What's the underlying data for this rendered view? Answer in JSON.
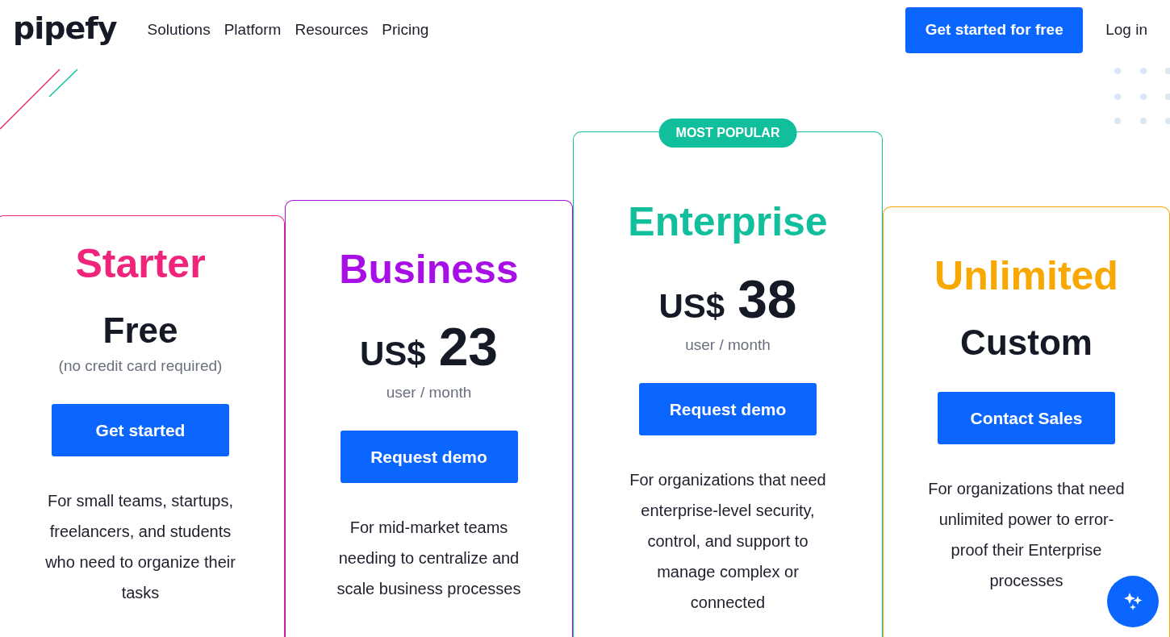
{
  "header": {
    "logo": "pipefy",
    "nav": [
      "Solutions",
      "Platform",
      "Resources",
      "Pricing"
    ],
    "cta": "Get started for free",
    "login": "Log in"
  },
  "plans": [
    {
      "name": "Starter",
      "color": "#f0247a",
      "amount": "Free",
      "note": "(no credit card required)",
      "button": "Get started",
      "description": "For small teams, startups, freelancers, and students who need to organize their tasks"
    },
    {
      "name": "Business",
      "color": "#a80ee6",
      "currency": "US$",
      "amount": "23",
      "note": "user / month",
      "button": "Request demo",
      "description": "For mid-market teams needing to centralize and scale business processes"
    },
    {
      "name": "Enterprise",
      "color": "#12bf9d",
      "badge": "MOST POPULAR",
      "currency": "US$",
      "amount": "38",
      "note": "user / month",
      "button": "Request demo",
      "description": "For organizations that need enterprise-level security, control, and support to manage complex or connected"
    },
    {
      "name": "Unlimited",
      "color": "#f8a800",
      "amount": "Custom",
      "button": "Contact Sales",
      "description": "For organizations that need unlimited power to error-proof their Enterprise processes"
    }
  ]
}
